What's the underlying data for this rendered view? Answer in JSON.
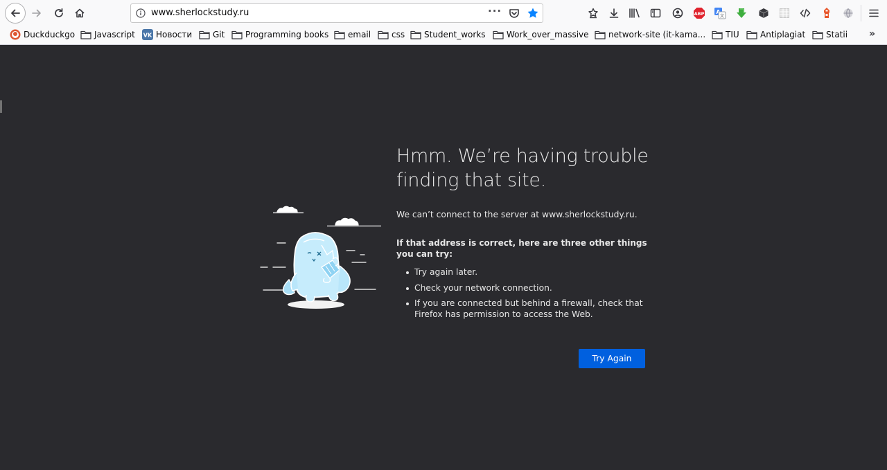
{
  "browser": {
    "url": "www.sherlockstudy.ru",
    "accent": "#0060df"
  },
  "toolbar_icons": [
    "back-arrow-icon",
    "forward-arrow-icon",
    "reload-icon",
    "home-icon",
    "site-info-icon",
    "page-actions-icon",
    "pocket-icon",
    "bookmark-star-icon",
    "reader-icon",
    "download-icon",
    "library-icon",
    "sidebar-icon",
    "account-icon",
    "adblock-icon",
    "translate-icon",
    "download-helper-icon",
    "extension-box-icon",
    "extension-grid-icon",
    "dev-tools-icon",
    "extension-tower-icon",
    "globe-icon",
    "menu-icon"
  ],
  "bookmarks": [
    {
      "label": "Duckduckgo",
      "icon": "duckduckgo-icon"
    },
    {
      "label": "Javascript",
      "icon": "folder-icon"
    },
    {
      "label": "Новости",
      "icon": "vk-icon"
    },
    {
      "label": "Git",
      "icon": "folder-icon"
    },
    {
      "label": "Programming books",
      "icon": "folder-icon"
    },
    {
      "label": "email",
      "icon": "folder-icon"
    },
    {
      "label": "css",
      "icon": "folder-icon"
    },
    {
      "label": "Student_works",
      "icon": "folder-icon"
    },
    {
      "label": "Work_over_massive",
      "icon": "folder-icon"
    },
    {
      "label": "network-site (it-kama...",
      "icon": "folder-icon"
    },
    {
      "label": "TIU",
      "icon": "folder-icon"
    },
    {
      "label": "Antiplagiat",
      "icon": "folder-icon"
    },
    {
      "label": "Statii",
      "icon": "folder-icon"
    }
  ],
  "bookmarks_overflow": "»",
  "error": {
    "title": "Hmm. We’re having trouble finding that site.",
    "description": "We can’t connect to the server at www.sherlockstudy.ru.",
    "subheading": "If that address is correct, here are three other things you can try:",
    "tips": [
      "Try again later.",
      "Check your network connection.",
      "If you are connected but behind a firewall, check that Firefox has permission to access the Web."
    ],
    "button_label": "Try Again"
  },
  "colors": {
    "page_bg": "#2a2a2e",
    "chrome_bg": "#f9f9fa",
    "text": "#e6e6e6",
    "button": "#0060df"
  }
}
